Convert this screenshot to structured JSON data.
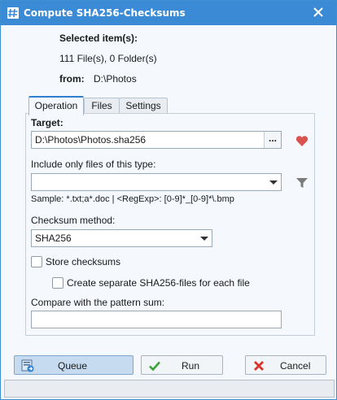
{
  "window": {
    "title": "Compute SHA256-Checksums"
  },
  "info": {
    "selected_label": "Selected item(s):",
    "count_text": "111 File(s), 0 Folder(s)",
    "from_label": "from:",
    "from_value": "D:\\Photos"
  },
  "tabs": [
    {
      "label": "Operation",
      "active": true
    },
    {
      "label": "Files",
      "active": false
    },
    {
      "label": "Settings",
      "active": false
    }
  ],
  "operation": {
    "target_label": "Target:",
    "target_value": "D:\\Photos\\Photos.sha256",
    "browse_label": "...",
    "include_label": "Include only files of this type:",
    "include_value": "",
    "sample_text": "Sample: *.txt;a*.doc | <RegExp>: [0-9]*_[0-9]*\\.bmp",
    "method_label": "Checksum method:",
    "method_value": "SHA256",
    "store_label": "Store checksums",
    "store_checked": false,
    "separate_label": "Create separate SHA256-files for each file",
    "separate_checked": false,
    "compare_label": "Compare with the pattern sum:",
    "compare_value": ""
  },
  "buttons": {
    "queue": "Queue",
    "run": "Run",
    "cancel": "Cancel"
  },
  "colors": {
    "titlebar": "#3b8ad6",
    "heart": "#d9534f",
    "run_check": "#3aa13a",
    "cancel_x": "#d9342b"
  },
  "icons": {
    "app": "hash-icon",
    "close": "close-icon",
    "favorite": "heart-icon",
    "filter": "filter-icon",
    "queue": "queue-icon",
    "run": "check-icon",
    "cancel": "x-icon"
  }
}
